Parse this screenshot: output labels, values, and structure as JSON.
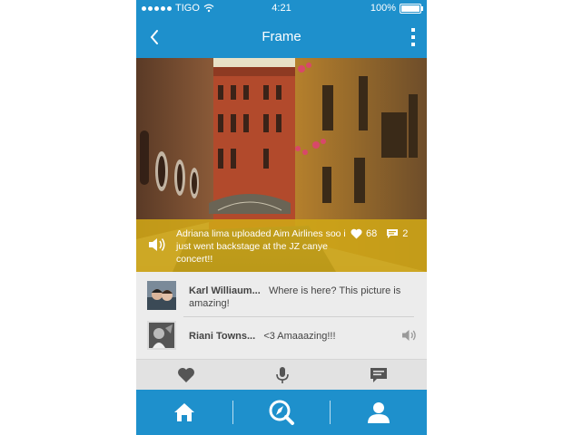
{
  "status": {
    "carrier": "TIGO",
    "time": "4:21",
    "battery": "100%"
  },
  "nav": {
    "title": "Frame"
  },
  "post": {
    "caption": "Adriana lima uploaded  Aim Airlines soo i just went backstage at the JZ canye concert!!",
    "likes": "68",
    "comments": "2"
  },
  "comments": [
    {
      "name": "Karl Williaum...",
      "text": "Where is here? This picture is amazing!"
    },
    {
      "name": "Riani Towns...",
      "text": "<3  Amaaazing!!!"
    }
  ],
  "icons": {
    "back": "chevron-left-icon",
    "more": "more-vertical-icon",
    "like": "heart-icon",
    "voice": "microphone-icon",
    "comment": "speech-bubble-icon",
    "home": "home-icon",
    "explore": "compass-search-icon",
    "profile": "person-icon"
  },
  "colors": {
    "primary": "#1e90cc",
    "caption_overlay": "#cfa617"
  }
}
